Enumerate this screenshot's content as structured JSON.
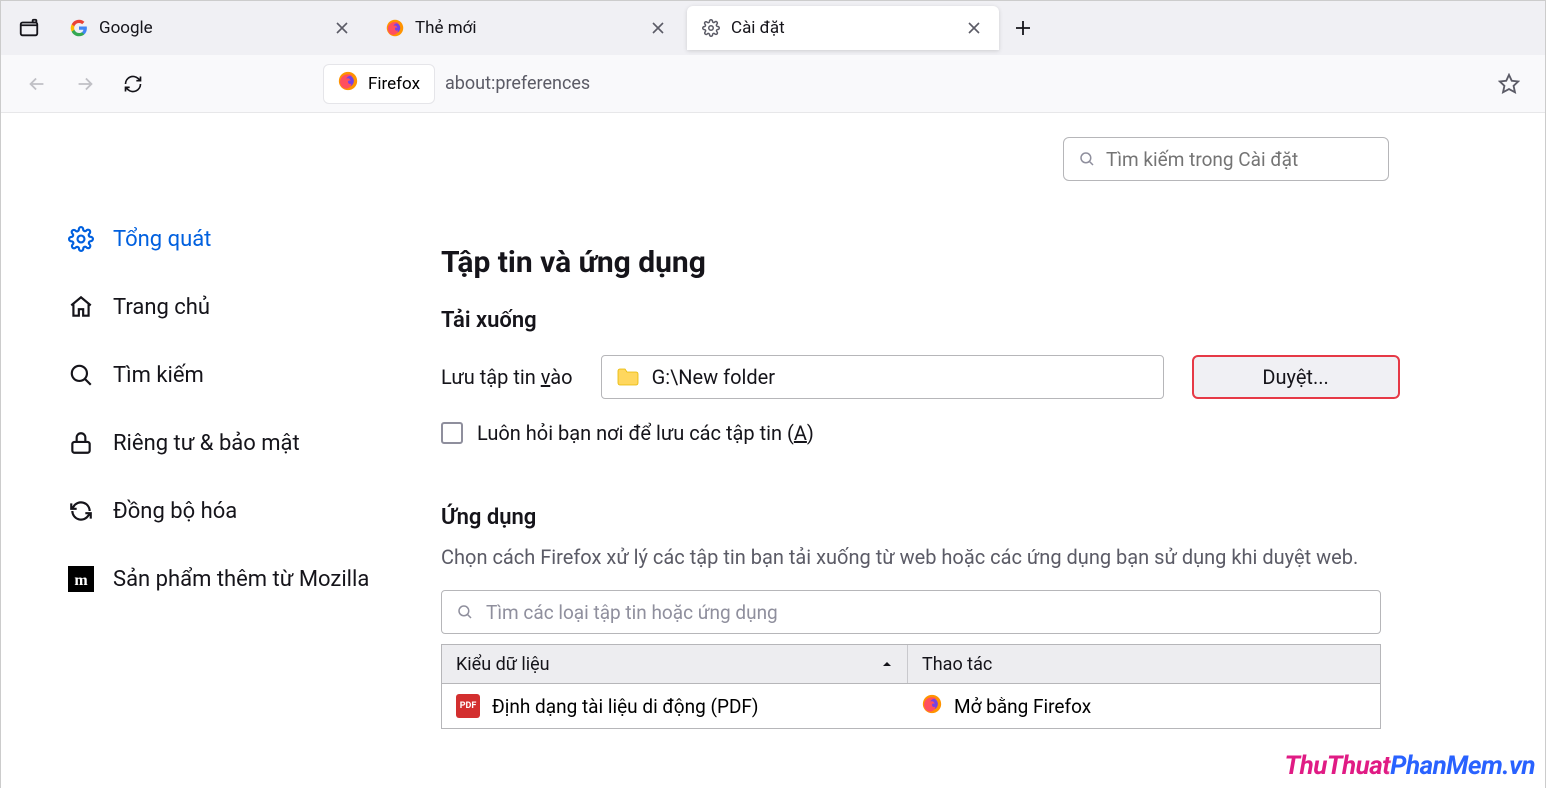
{
  "tabs": [
    {
      "label": "Google"
    },
    {
      "label": "Thẻ mới"
    },
    {
      "label": "Cài đặt"
    }
  ],
  "toolbar": {
    "identity_label": "Firefox",
    "url": "about:preferences"
  },
  "sidebar": {
    "items": [
      {
        "label": "Tổng quát"
      },
      {
        "label": "Trang chủ"
      },
      {
        "label": "Tìm kiếm"
      },
      {
        "label": "Riêng tư & bảo mật"
      },
      {
        "label": "Đồng bộ hóa"
      },
      {
        "label": "Sản phẩm thêm từ Mozilla"
      }
    ]
  },
  "settings_search": {
    "placeholder": "Tìm kiếm trong Cài đặt"
  },
  "main": {
    "heading": "Tập tin và ứng dụng",
    "downloads": {
      "title": "Tải xuống",
      "save_label_pre": "Lưu tập tin ",
      "save_label_key": "v",
      "save_label_post": "ào",
      "path": "G:\\New folder",
      "browse": "Duyệt...",
      "ask_label_pre": "Luôn hỏi bạn nơi để lưu các tập tin (",
      "ask_label_key": "A",
      "ask_label_post": ")"
    },
    "apps": {
      "title": "Ứng dụng",
      "desc": "Chọn cách Firefox xử lý các tập tin bạn tải xuống từ web hoặc các ứng dụng bạn sử dụng khi duyệt web.",
      "search_placeholder": "Tìm các loại tập tin hoặc ứng dụng",
      "col1": "Kiểu dữ liệu",
      "col2": "Thao tác",
      "rows": [
        {
          "type": "Định dạng tài liệu di động (PDF)",
          "action": "Mở bằng Firefox"
        }
      ]
    }
  },
  "watermark": {
    "a": "ThuThuat",
    "b": "PhanMem",
    "c": ".vn"
  }
}
